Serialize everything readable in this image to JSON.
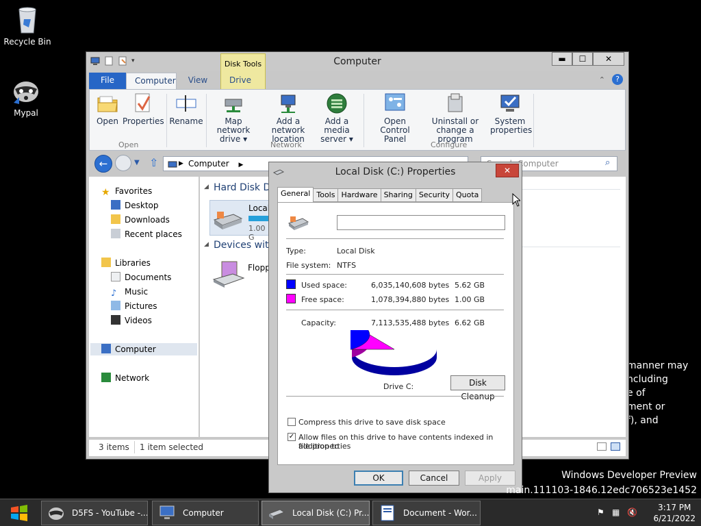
{
  "desktop": {
    "icons": [
      {
        "label": "Recycle Bin"
      },
      {
        "label": "Mypal"
      }
    ],
    "background_text": [
      "manner may",
      "ncluding",
      "e of",
      "ment or",
      "f), and"
    ],
    "watermark": {
      "line1": "Windows Developer Preview",
      "line2": "main.111103-1846.12edc706523e1452"
    }
  },
  "explorer": {
    "title": "Computer",
    "context_tab": "Disk Tools",
    "tabs": [
      "File",
      "Computer",
      "View",
      "Drive"
    ],
    "ribbon": {
      "buttons": [
        {
          "label": "Open"
        },
        {
          "label": "Properties"
        },
        {
          "label": "Rename"
        },
        {
          "label": "Map network drive ▾"
        },
        {
          "label": "Add a network location"
        },
        {
          "label": "Add a media server ▾"
        },
        {
          "label": "Open Control Panel"
        },
        {
          "label": "Uninstall or change a program"
        },
        {
          "label": "System properties"
        }
      ],
      "groups": [
        "Open",
        "Network",
        "Configure"
      ]
    },
    "address": {
      "path": "Computer",
      "search_placeholder": "Search Computer"
    },
    "nav": {
      "favorites": "Favorites",
      "favorites_items": [
        "Desktop",
        "Downloads",
        "Recent places"
      ],
      "libraries": "Libraries",
      "libraries_items": [
        "Documents",
        "Music",
        "Pictures",
        "Videos"
      ],
      "computer": "Computer",
      "network": "Network"
    },
    "content": {
      "hard_disk_heading": "Hard Disk D",
      "local_disk_label": "Local",
      "local_disk_free": "1.00 G",
      "devices_heading": "Devices with",
      "floppy_label": "Flopp"
    },
    "status": {
      "items": "3 items",
      "selected": "1 item selected"
    }
  },
  "dialog": {
    "title": "Local Disk (C:) Properties",
    "tabs": [
      "General",
      "Tools",
      "Hardware",
      "Sharing",
      "Security",
      "Quota"
    ],
    "name_value": "",
    "type_label": "Type:",
    "type_value": "Local Disk",
    "fs_label": "File system:",
    "fs_value": "NTFS",
    "used_label": "Used space:",
    "used_bytes": "6,035,140,608 bytes",
    "used_gb": "5.62 GB",
    "free_label": "Free space:",
    "free_bytes": "1,078,394,880 bytes",
    "free_gb": "1.00 GB",
    "capacity_label": "Capacity:",
    "capacity_bytes": "7,113,535,488 bytes",
    "capacity_gb": "6.62 GB",
    "drive_label": "Drive C:",
    "disk_cleanup": "Disk Cleanup",
    "compress_label": "Compress this drive to save disk space",
    "compress_checked": false,
    "index_label_1": "Allow files on this drive to have contents indexed in addition to",
    "index_label_2": "file properties",
    "index_checked": true,
    "ok": "OK",
    "cancel": "Cancel",
    "apply": "Apply",
    "colors": {
      "used": "#0000ff",
      "free": "#ff00ff"
    },
    "used_fraction": 0.8484
  },
  "taskbar": {
    "buttons": [
      {
        "label": "D5FS - YouTube -..."
      },
      {
        "label": "Computer"
      },
      {
        "label": "Local Disk (C:) Pr..."
      },
      {
        "label": "Document - Wor..."
      }
    ],
    "time": "3:17 PM",
    "date": "6/21/2022"
  }
}
